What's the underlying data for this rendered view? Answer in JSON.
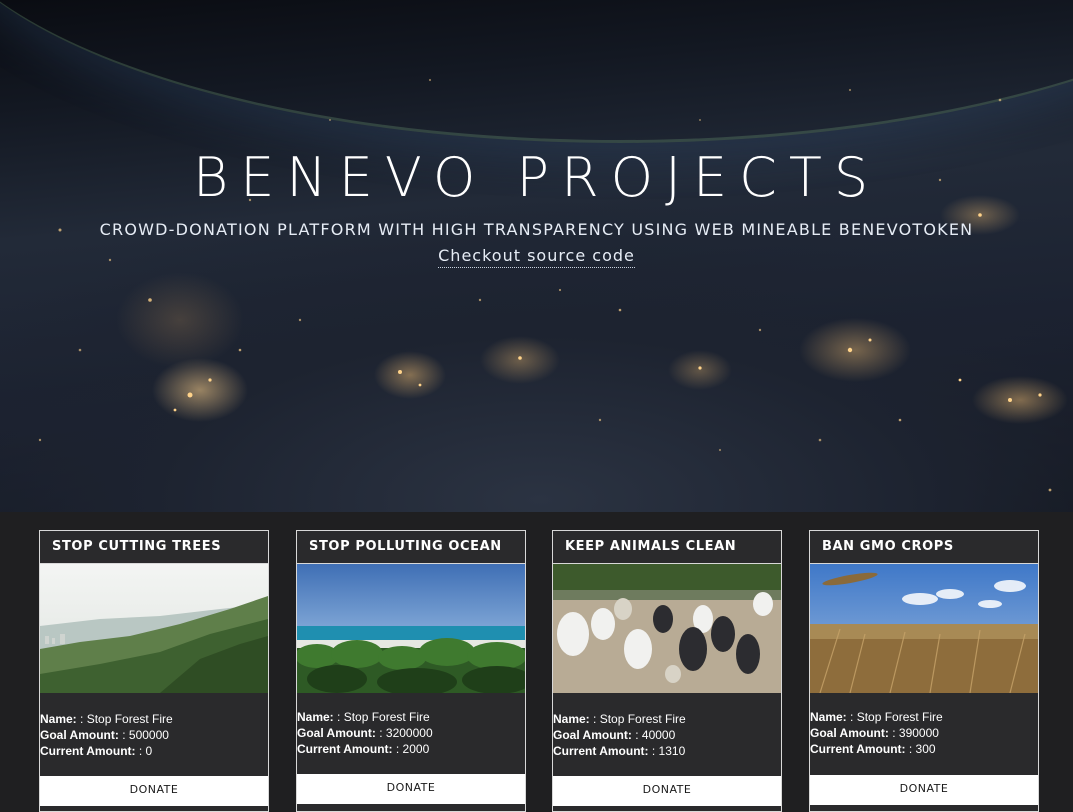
{
  "hero": {
    "title": "BENEVO PROJECTS",
    "subtitle": "Crowd-donation platform with high transparency using web mineable BenevoToken",
    "source_link": "Checkout source code"
  },
  "labels": {
    "name": "Name:",
    "goal": "Goal Amount:",
    "current": "Current Amount:"
  },
  "projects": [
    {
      "title": "Stop Cutting Trees",
      "name": ": Stop Forest Fire",
      "goal": ": 500000",
      "current": ": 0",
      "donate": "Donate",
      "image": "forest-hillside-photo"
    },
    {
      "title": "Stop Polluting Ocean",
      "name": ": Stop Forest Fire",
      "goal": ": 3200000",
      "current": ": 2000",
      "donate": "Donate",
      "image": "tropical-beach-photo"
    },
    {
      "title": "Keep Animals Clean",
      "name": ": Stop Forest Fire",
      "goal": ": 40000",
      "current": ": 1310",
      "donate": "Donate",
      "image": "ducks-farm-photo"
    },
    {
      "title": "Ban GMO Crops",
      "name": ": Stop Forest Fire",
      "goal": ": 390000",
      "current": ": 300",
      "donate": "Donate",
      "image": "wheat-field-photo"
    }
  ]
}
